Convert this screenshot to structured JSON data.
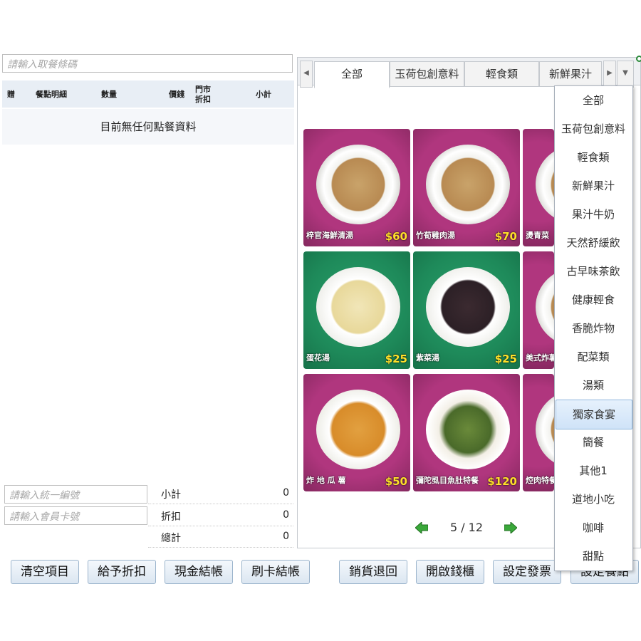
{
  "left": {
    "barcode_placeholder": "請輸入取餐條碼",
    "columns": {
      "gift": "贈",
      "item": "餐點明細",
      "qty": "數量",
      "price": "價錢",
      "discount_line1": "門市",
      "discount_line2": "折扣",
      "subtotal": "小計"
    },
    "empty_message": "目前無任何點餐資料",
    "tax_id_placeholder": "請輸入統一編號",
    "member_placeholder": "請輸入會員卡號",
    "totals": {
      "subtotal_label": "小計",
      "subtotal_value": "0",
      "discount_label": "折扣",
      "discount_value": "0",
      "total_label": "總計",
      "total_value": "0"
    }
  },
  "buttons": {
    "clear": "清空項目",
    "discount": "給予折扣",
    "cash": "現金結帳",
    "card": "刷卡結帳",
    "return": "銷貨退回",
    "drawer": "開啟錢櫃",
    "invoice": "設定發票",
    "set_meal": "設定餐點"
  },
  "tabs": [
    "全部",
    "玉荷包創意料",
    "輕食類",
    "新鮮果汁"
  ],
  "products": [
    {
      "name": "梓官海鮮清湯",
      "price": "$60"
    },
    {
      "name": "竹荀雞肉湯",
      "price": "$70"
    },
    {
      "name": "燙青菜",
      "price": ""
    },
    {
      "name": "蛋花湯",
      "price": "$25"
    },
    {
      "name": "紫菜湯",
      "price": "$25"
    },
    {
      "name": "美式炸薯",
      "price": ""
    },
    {
      "name": "炸 地 瓜 薯",
      "price": "$50"
    },
    {
      "name": "彌陀虱目魚肚特餐",
      "price": "$120"
    },
    {
      "name": "焢肉特餐",
      "price": ""
    }
  ],
  "pager": {
    "text": "5 / 12"
  },
  "dropdown": {
    "items": [
      "全部",
      "玉荷包創意料",
      "輕食類",
      "新鮮果汁",
      "果汁牛奶",
      "天然舒緩飲",
      "古早味茶飲",
      "健康輕食",
      "香脆炸物",
      "配菜類",
      "湯類",
      "獨家食宴",
      "簡餐",
      "其他1",
      "道地小吃",
      "咖啡",
      "甜點"
    ],
    "selected": "獨家食宴"
  },
  "colors": {
    "accent": "#9bb4cc",
    "price": "#ffe02a",
    "magenta_bg": "#b0367e",
    "green_bg": "#1e8a5a"
  }
}
